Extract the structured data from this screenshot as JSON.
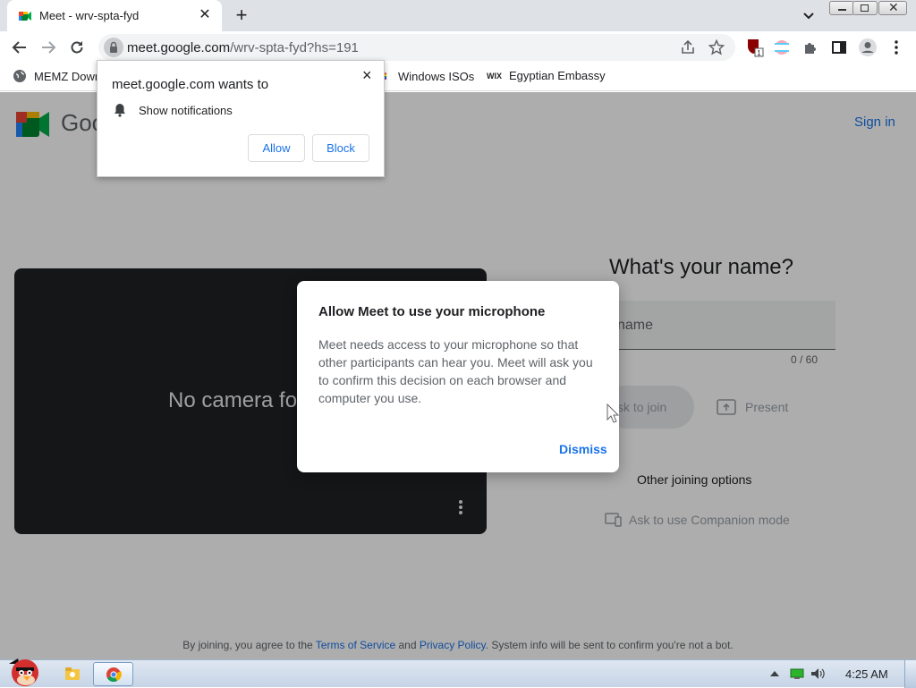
{
  "tab": {
    "title": "Meet - wrv-spta-fyd",
    "close": "✕"
  },
  "new_tab": "+",
  "omnibox": {
    "host": "meet.google.com",
    "path": "/wrv-spta-fyd?hs=191"
  },
  "bookmarks": [
    {
      "label": "MEMZ Down"
    },
    {
      "label": "Windows ISOs"
    },
    {
      "label": "Egyptian Embassy",
      "icon_text": "WIX"
    }
  ],
  "extension_badge": "1",
  "notification": {
    "title": "meet.google.com wants to",
    "item": "Show notifications",
    "allow": "Allow",
    "block": "Block",
    "close": "×"
  },
  "meet": {
    "logo_text": "Goo",
    "sign_in": "Sign in",
    "no_camera": "No camera fo",
    "heading": "What's your name?",
    "name_placeholder": "name",
    "char_count": "0 / 60",
    "ask_to_join": "sk to join",
    "present": "Present",
    "other_options": "Other joining options",
    "companion": "Ask to use Companion mode",
    "footer_prefix": "By joining, you agree to the",
    "terms": "Terms of Service",
    "and": "and",
    "privacy": "Privacy Policy",
    "footer_suffix": ". System info will be sent to confirm you're not a bot."
  },
  "dialog": {
    "title": "Allow Meet to use your microphone",
    "body": "Meet needs access to your microphone so that other participants can hear you. Meet will ask you to confirm this decision on each browser and computer you use.",
    "dismiss": "Dismiss"
  },
  "taskbar": {
    "time": "4:25 AM"
  },
  "colors": {
    "accent": "#1a73e8",
    "tabstrip": "#dee1e6",
    "dim": "rgba(0,0,0,0.32)"
  }
}
